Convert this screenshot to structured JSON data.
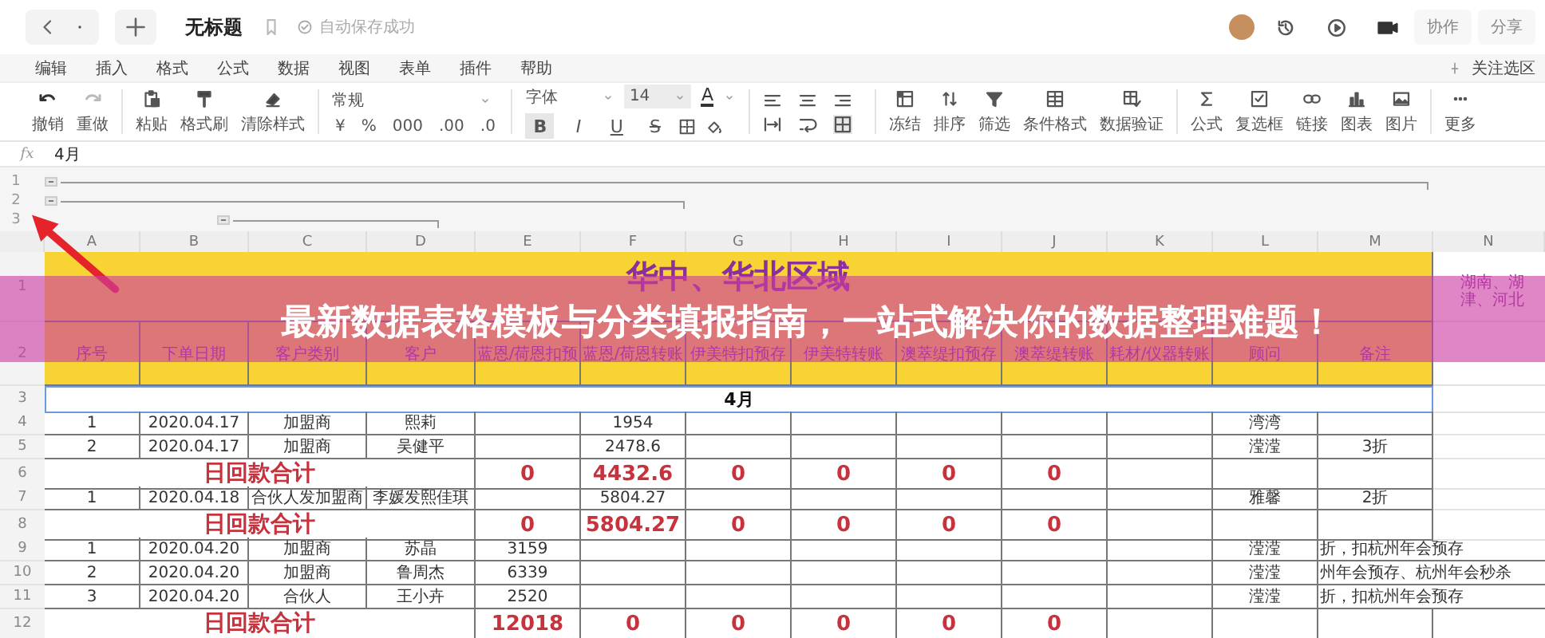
{
  "top_bar": {
    "title": "无标题",
    "save_status": "自动保存成功",
    "actions": [
      "协作",
      "分享"
    ]
  },
  "menu": {
    "items": [
      "编辑",
      "插入",
      "格式",
      "公式",
      "数据",
      "视图",
      "表单",
      "插件",
      "帮助"
    ],
    "focus_toggle": "关注选区"
  },
  "toolbar": {
    "history": [
      {
        "label": "撤销"
      },
      {
        "label": "重做"
      }
    ],
    "clipboard": [
      {
        "label": "粘贴"
      },
      {
        "label": "格式刷"
      },
      {
        "label": "清除样式"
      }
    ],
    "number_format": {
      "value": "常规",
      "buttons": [
        "¥",
        "%",
        "000",
        ".00",
        ".0"
      ]
    },
    "font": {
      "family": "字体",
      "size": "14",
      "color_glyph": "A",
      "styles": [
        {
          "label": "B",
          "on": true
        },
        {
          "label": "I",
          "on": false
        },
        {
          "label": "U",
          "on": false
        },
        {
          "label": "S",
          "on": false
        }
      ]
    },
    "data_tools": [
      {
        "label": "冻结"
      },
      {
        "label": "排序"
      },
      {
        "label": "筛选"
      },
      {
        "label": "条件格式"
      },
      {
        "label": "数据验证"
      }
    ],
    "insert_tools": [
      {
        "label": "公式"
      },
      {
        "label": "复选框"
      },
      {
        "label": "链接"
      },
      {
        "label": "图表"
      },
      {
        "label": "图片"
      }
    ],
    "more": {
      "label": "更多"
    }
  },
  "formula_bar": {
    "label": "fx",
    "value": "4月"
  },
  "outline_levels": [
    "1",
    "2",
    "3"
  ],
  "sheet": {
    "columns": [
      "A",
      "B",
      "C",
      "D",
      "E",
      "F",
      "G",
      "H",
      "I",
      "J",
      "K",
      "L",
      "M",
      "N"
    ],
    "rows": [
      {
        "number": "1",
        "kind": "title",
        "text": "华中、华北区域",
        "note": "湖南、湖津、河北"
      },
      {
        "number": "2",
        "kind": "header",
        "cells": {
          "A": "序号",
          "B": "下单日期",
          "C": "客户类别",
          "D": "客户",
          "E": "蓝恩/荷恩扣预",
          "F": "蓝恩/荷恩转账",
          "G": "伊美特扣预存",
          "H": "伊美特转账",
          "I": "澳萃缇扣预存",
          "J": "澳萃缇转账",
          "K": "耗材/仪器转账",
          "L": "顾问",
          "M": "备注"
        }
      },
      {
        "number": "3",
        "kind": "month",
        "text": "4月"
      },
      {
        "number": "4",
        "kind": "data",
        "cells": {
          "A": "1",
          "B": "2020.04.17",
          "C": "加盟商",
          "D": "熙莉",
          "F": "1954",
          "L": "湾湾"
        }
      },
      {
        "number": "5",
        "kind": "data",
        "cells": {
          "A": "2",
          "B": "2020.04.17",
          "C": "加盟商",
          "D": "吴健平",
          "F": "2478.6",
          "L": "滢滢",
          "M": "3折"
        }
      },
      {
        "number": "6",
        "kind": "total",
        "label": "日回款合计",
        "cells": {
          "E": "0",
          "F": "4432.6",
          "G": "0",
          "H": "0",
          "I": "0",
          "J": "0"
        }
      },
      {
        "number": "7",
        "kind": "data",
        "cells": {
          "A": "1",
          "B": "2020.04.18",
          "C": "合伙人发加盟商",
          "D": "李媛发熙佳琪",
          "F": "5804.27",
          "L": "雅馨",
          "M": "2折"
        }
      },
      {
        "number": "8",
        "kind": "total",
        "label": "日回款合计",
        "cells": {
          "E": "0",
          "F": "5804.27",
          "G": "0",
          "H": "0",
          "I": "0",
          "J": "0"
        }
      },
      {
        "number": "9",
        "kind": "data",
        "cells": {
          "A": "1",
          "B": "2020.04.20",
          "C": "加盟商",
          "D": "苏晶",
          "E": "3159",
          "L": "滢滢",
          "M": "折，扣杭州年会预存"
        }
      },
      {
        "number": "10",
        "kind": "data",
        "cells": {
          "A": "2",
          "B": "2020.04.20",
          "C": "加盟商",
          "D": "鲁周杰",
          "E": "6339",
          "L": "滢滢",
          "M": "州年会预存、杭州年会秒杀"
        }
      },
      {
        "number": "11",
        "kind": "data",
        "cells": {
          "A": "3",
          "B": "2020.04.20",
          "C": "合伙人",
          "D": "王小卉",
          "E": "2520",
          "L": "滢滢",
          "M": "折，扣杭州年会预存"
        }
      },
      {
        "number": "12",
        "kind": "total",
        "label": "日回款合计",
        "cells": {
          "E": "12018",
          "F": "0",
          "G": "0",
          "H": "0",
          "I": "0",
          "J": "0"
        }
      }
    ]
  },
  "banner": {
    "text": "最新数据表格模板与分类填报指南，一站式解决你的数据整理难题！"
  }
}
